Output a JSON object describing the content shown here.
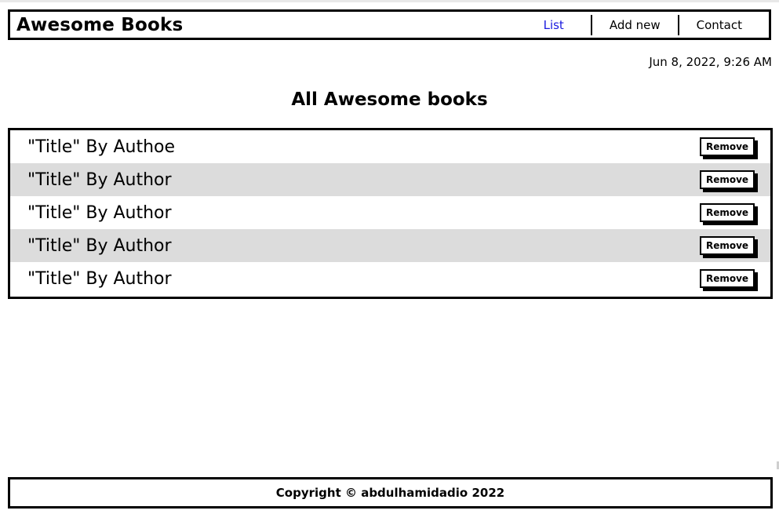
{
  "header": {
    "brand": "Awesome Books",
    "nav": [
      {
        "label": "List",
        "active": true
      },
      {
        "label": "Add new",
        "active": false
      },
      {
        "label": "Contact",
        "active": false
      }
    ]
  },
  "datetime": "Jun 8, 2022, 9:26 AM",
  "section_title": "All Awesome books",
  "books": [
    {
      "text": "\"Title\" By Authoe",
      "remove_label": "Remove"
    },
    {
      "text": "\"Title\" By Author",
      "remove_label": "Remove"
    },
    {
      "text": "\"Title\" By Author",
      "remove_label": "Remove"
    },
    {
      "text": "\"Title\" By Author",
      "remove_label": "Remove"
    },
    {
      "text": "\"Title\" By Author",
      "remove_label": "Remove"
    }
  ],
  "footer": {
    "copyright": "Copyright © abdulhamidadio 2022"
  },
  "colors": {
    "active_link": "#1a1adf",
    "row_shade": "#dcdcdc"
  }
}
